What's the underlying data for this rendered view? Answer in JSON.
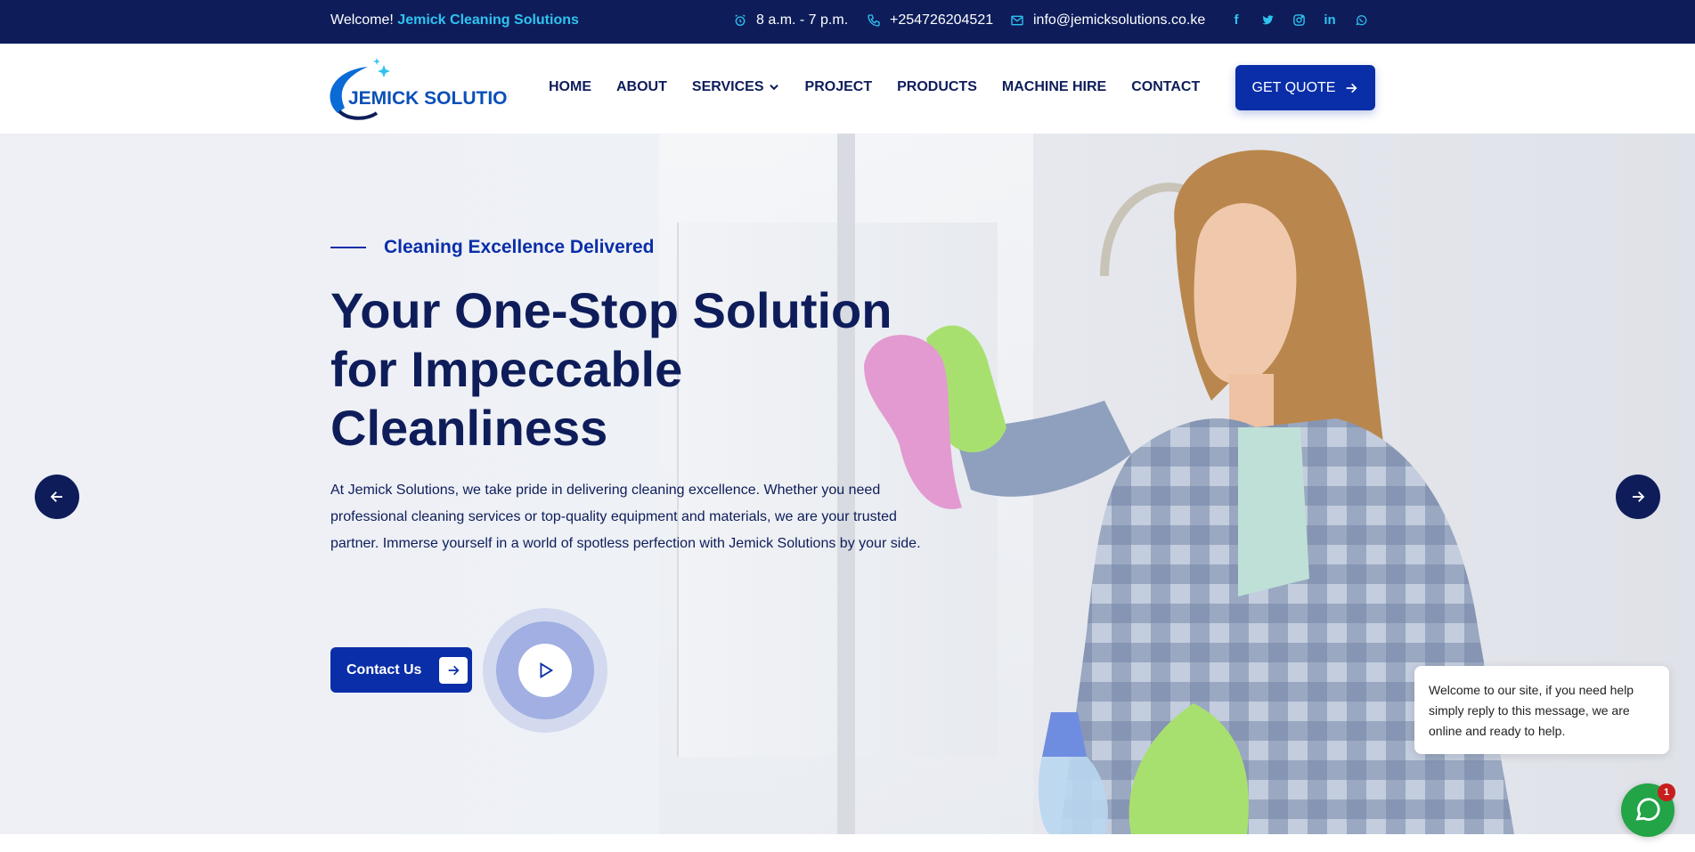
{
  "topbar": {
    "welcome": "Welcome!",
    "brand": "Jemick Cleaning Solutions",
    "hours": "8 a.m. - 7 p.m.",
    "phone": "+254726204521",
    "email": "info@jemicksolutions.co.ke",
    "socials": [
      "facebook-icon",
      "twitter-icon",
      "instagram-icon",
      "linkedin-icon",
      "whatsapp-icon"
    ]
  },
  "header": {
    "logo_text": "JEMICK SOLUTIONS",
    "nav": [
      "HOME",
      "ABOUT",
      "SERVICES",
      "PROJECT",
      "PRODUCTS",
      "MACHINE HIRE",
      "CONTACT"
    ],
    "quote_label": "GET QUOTE"
  },
  "hero": {
    "kicker": "Cleaning Excellence Delivered",
    "headline": "Your One-Stop Solution for Impeccable Cleanliness",
    "lead": "At Jemick Solutions, we take pride in delivering cleaning excellence. Whether you need professional cleaning services or top-quality equipment and materials, we are your trusted partner. Immerse yourself in a world of spotless perfection with Jemick Solutions by your side.",
    "contact_label": "Contact Us"
  },
  "chat": {
    "message": "Welcome to our site, if you need help simply reply to this message, we are online and ready to help.",
    "badge": "1"
  },
  "colors": {
    "navy": "#0e1d5a",
    "blue": "#0a2ea8",
    "cyan": "#2fc3f0",
    "chat_green": "#22a447"
  }
}
